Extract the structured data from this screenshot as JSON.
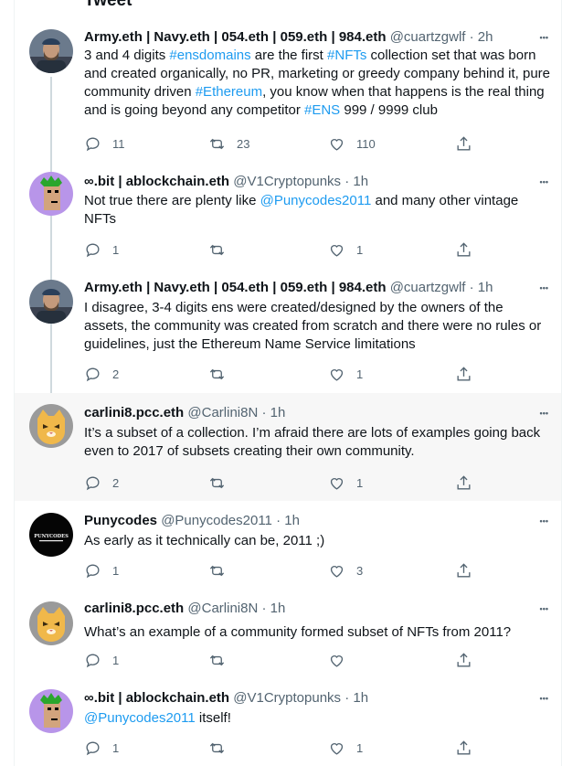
{
  "page": {
    "title": "Tweet"
  },
  "tweets": [
    {
      "name": "Army.eth | Navy.eth | 054.eth | 059.eth | 984.eth",
      "handle": "@cuartzgwlf",
      "time": "2h",
      "body": [
        {
          "t": "3 and 4 digits "
        },
        {
          "t": "#ensdomains",
          "link": true
        },
        {
          "t": " are the first "
        },
        {
          "t": "#NFTs",
          "link": true
        },
        {
          "t": " collection set that was born and created organically, no PR, marketing or greedy company behind it, pure community driven "
        },
        {
          "t": "#Ethereum",
          "link": true
        },
        {
          "t": ", you know when that happens is the real thing and is going beyond any competitor "
        },
        {
          "t": "#ENS",
          "link": true
        },
        {
          "t": " 999 / 9999 club"
        }
      ],
      "replies": "11",
      "retweets": "23",
      "likes": "110",
      "avatar": "man"
    },
    {
      "name": "∞.bit | ablockchain.eth",
      "handle": "@V1Cryptopunks",
      "time": "1h",
      "body": [
        {
          "t": "Not true there are plenty like "
        },
        {
          "t": "@Punycodes2011",
          "link": true
        },
        {
          "t": " and many other vintage NFTs"
        }
      ],
      "replies": "1",
      "retweets": "",
      "likes": "1",
      "avatar": "punk"
    },
    {
      "name": "Army.eth | Navy.eth | 054.eth | 059.eth | 984.eth",
      "handle": "@cuartzgwlf",
      "time": "1h",
      "body": [
        {
          "t": "I disagree, 3-4 digits ens were created/designed by the owners of the assets, the community was created from scratch and there were no rules or guidelines, just the Ethereum Name Service limitations"
        }
      ],
      "replies": "2",
      "retweets": "",
      "likes": "1",
      "avatar": "man"
    },
    {
      "name": "carlini8.pcc.eth",
      "handle": "@Carlini8N",
      "time": "1h",
      "body": [
        {
          "t": "It’s a subset of a collection. I’m afraid there are lots of examples going back even to 2017 of subsets creating their own community."
        }
      ],
      "replies": "2",
      "retweets": "",
      "likes": "1",
      "avatar": "cat"
    },
    {
      "name": "Punycodes",
      "handle": "@Punycodes2011",
      "time": "1h",
      "body": [
        {
          "t": "As early as it technically can be, 2011 ;)"
        }
      ],
      "replies": "1",
      "retweets": "",
      "likes": "3",
      "avatar": "puny",
      "avatar_text": "PUNYCODES"
    },
    {
      "name": "carlini8.pcc.eth",
      "handle": "@Carlini8N",
      "time": "1h",
      "body": [
        {
          "t": "What’s an example of a community formed subset of NFTs from 2011?"
        }
      ],
      "replies": "1",
      "retweets": "",
      "likes": "",
      "avatar": "cat"
    },
    {
      "name": "∞.bit | ablockchain.eth",
      "handle": "@V1Cryptopunks",
      "time": "1h",
      "body": [
        {
          "t": "@Punycodes2011",
          "link": true
        },
        {
          "t": " itself!"
        }
      ],
      "replies": "1",
      "retweets": "",
      "likes": "1",
      "avatar": "punk"
    }
  ],
  "icons": {
    "reply": "reply-icon",
    "retweet": "retweet-icon",
    "like": "heart-icon",
    "share": "share-icon",
    "more": "more-icon"
  },
  "colors": {
    "link": "#1d9bf0",
    "secondary": "#536471",
    "highlight_bg": "#f7f7f7"
  }
}
